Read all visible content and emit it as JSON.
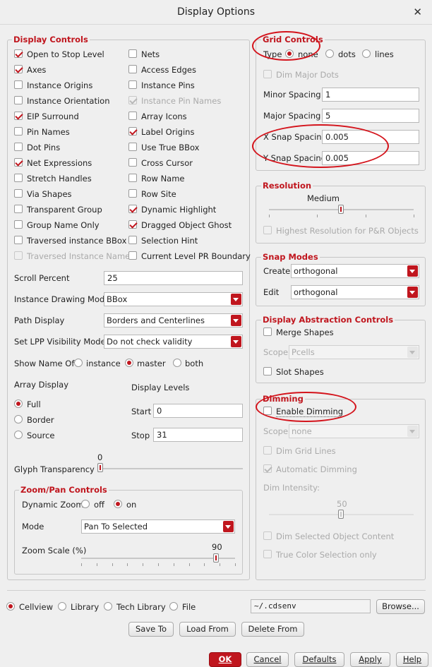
{
  "window": {
    "title": "Display Options",
    "close_glyph": "✕"
  },
  "display_controls": {
    "title": "Display Controls",
    "left_items": [
      {
        "label": "Open to Stop Level",
        "checked": true,
        "disabled": false
      },
      {
        "label": "Axes",
        "checked": true,
        "disabled": false
      },
      {
        "label": "Instance Origins",
        "checked": false,
        "disabled": false
      },
      {
        "label": "Instance Orientation",
        "checked": false,
        "disabled": false
      },
      {
        "label": "EIP Surround",
        "checked": true,
        "disabled": false
      },
      {
        "label": "Pin Names",
        "checked": false,
        "disabled": false
      },
      {
        "label": "Dot Pins",
        "checked": false,
        "disabled": false
      },
      {
        "label": "Net Expressions",
        "checked": true,
        "disabled": false
      },
      {
        "label": "Stretch Handles",
        "checked": false,
        "disabled": false
      },
      {
        "label": "Via Shapes",
        "checked": false,
        "disabled": false
      },
      {
        "label": "Transparent Group",
        "checked": false,
        "disabled": false
      },
      {
        "label": "Group Name Only",
        "checked": false,
        "disabled": false
      },
      {
        "label": "Traversed instance BBox",
        "checked": false,
        "disabled": false
      },
      {
        "label": "Traversed Instance Name",
        "checked": false,
        "disabled": true
      }
    ],
    "right_items": [
      {
        "label": "Nets",
        "checked": false,
        "disabled": false
      },
      {
        "label": "Access Edges",
        "checked": false,
        "disabled": false
      },
      {
        "label": "Instance Pins",
        "checked": false,
        "disabled": false
      },
      {
        "label": "Instance Pin Names",
        "checked": true,
        "disabled": true
      },
      {
        "label": "Array Icons",
        "checked": false,
        "disabled": false
      },
      {
        "label": "Label Origins",
        "checked": true,
        "disabled": false
      },
      {
        "label": "Use True BBox",
        "checked": false,
        "disabled": false
      },
      {
        "label": "Cross Cursor",
        "checked": false,
        "disabled": false
      },
      {
        "label": "Row Name",
        "checked": false,
        "disabled": false
      },
      {
        "label": "Row Site",
        "checked": false,
        "disabled": false
      },
      {
        "label": "Dynamic Highlight",
        "checked": true,
        "disabled": false
      },
      {
        "label": "Dragged Object Ghost",
        "checked": true,
        "disabled": false
      },
      {
        "label": "Selection Hint",
        "checked": false,
        "disabled": false
      },
      {
        "label": "Current Level PR Boundary",
        "checked": false,
        "disabled": false
      }
    ],
    "scroll_percent": {
      "label": "Scroll Percent",
      "value": "25"
    },
    "instance_drawing_mode": {
      "label": "Instance Drawing Mode",
      "value": "BBox"
    },
    "path_display": {
      "label": "Path Display",
      "value": "Borders and Centerlines"
    },
    "lpp_visibility": {
      "label": "Set LPP Visibility Mode",
      "value": "Do not check validity"
    },
    "show_name_of": {
      "label": "Show Name Of",
      "options": [
        "instance",
        "master",
        "both"
      ],
      "selected": "master"
    },
    "array_display": {
      "label": "Array Display",
      "options": [
        "Full",
        "Border",
        "Source"
      ],
      "selected": "Full"
    },
    "display_levels": {
      "label": "Display Levels",
      "start_label": "Start",
      "start": "0",
      "stop_label": "Stop",
      "stop": "31"
    },
    "glyph_transparency": {
      "label": "Glyph Transparency :",
      "value": "0",
      "fraction": 0.0
    }
  },
  "zoom_pan": {
    "title": "Zoom/Pan Controls",
    "dynamic_zoom": {
      "label": "Dynamic Zoom",
      "options": [
        "off",
        "on"
      ],
      "selected": "on"
    },
    "mode": {
      "label": "Mode",
      "value": "Pan To Selected"
    },
    "zoom_scale": {
      "label": "Zoom Scale (%)",
      "value": "90",
      "fraction": 0.9
    }
  },
  "grid_controls": {
    "title": "Grid Controls",
    "type_label": "Type",
    "types": [
      "none",
      "dots",
      "lines"
    ],
    "selected_type": "none",
    "dim_major_dots": "Dim Major Dots",
    "minor_spacing": {
      "label": "Minor Spacing",
      "value": "1"
    },
    "major_spacing": {
      "label": "Major Spacing",
      "value": "5"
    },
    "x_snap": {
      "label": "X Snap Spacing",
      "value": "0.005"
    },
    "y_snap": {
      "label": "Y Snap Spacing",
      "value": "0.005"
    }
  },
  "resolution": {
    "title": "Resolution",
    "value_label": "Medium",
    "fraction": 0.5,
    "highest": "Highest Resolution for P&R Objects"
  },
  "snap_modes": {
    "title": "Snap Modes",
    "create": {
      "label": "Create",
      "value": "orthogonal"
    },
    "edit": {
      "label": "Edit",
      "value": "orthogonal"
    }
  },
  "abstraction": {
    "title": "Display Abstraction Controls",
    "merge_shapes": "Merge Shapes",
    "scope_label": "Scope",
    "scope_value": "Pcells",
    "slot_shapes": "Slot Shapes"
  },
  "dimming": {
    "title": "Dimming",
    "enable": "Enable Dimming",
    "scope_label": "Scope",
    "scope_value": "none",
    "dim_grid_lines": "Dim Grid Lines",
    "automatic_dimming": "Automatic Dimming",
    "dim_intensity": "Dim Intensity:",
    "intensity_value": "50",
    "intensity_fraction": 0.5,
    "dim_selected": "Dim Selected Object Content",
    "true_color": "True Color Selection only"
  },
  "bottom": {
    "sources": [
      "Cellview",
      "Library",
      "Tech Library",
      "File"
    ],
    "selected_source": "Cellview",
    "file_path": "~/.cdsenv",
    "browse": "Browse...",
    "save_to": "Save To",
    "load_from": "Load From",
    "delete_from": "Delete From"
  },
  "dialog_buttons": {
    "ok": "OK",
    "cancel": "Cancel",
    "defaults": "Defaults",
    "apply": "Apply",
    "help": "Help"
  },
  "accent_color": "#c0161e",
  "annotation_color": "#d4141c"
}
